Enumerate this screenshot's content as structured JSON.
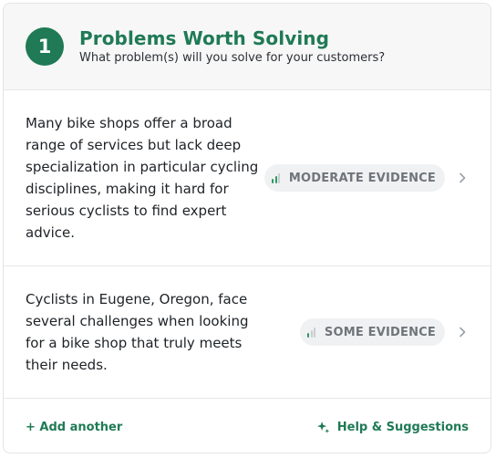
{
  "header": {
    "step_number": "1",
    "title": "Problems Worth Solving",
    "subtitle": "What problem(s) will you solve for your customers?"
  },
  "problems": [
    {
      "text": "Many bike shops offer a broad range of services but lack deep specialization in particular cycling disciplines, making it hard for serious cyclists to find expert advice.",
      "evidence_label": "MODERATE EVIDENCE",
      "evidence_level": 2,
      "evidence_max": 3
    },
    {
      "text": "Cyclists in Eugene, Oregon, face several challenges when looking for a bike shop that truly meets their needs.",
      "evidence_label": "SOME EVIDENCE",
      "evidence_level": 1,
      "evidence_max": 3
    }
  ],
  "footer": {
    "add_label": "+ Add another",
    "help_label": "Help & Suggestions"
  },
  "colors": {
    "brand_green": "#1f7a55",
    "signal_active": "#2f9a63",
    "signal_inactive": "#c9cdd1",
    "pill_bg": "#f0f1f2"
  },
  "icons": {
    "evidence": "signal-bars-icon",
    "row_action": "chevron-right-icon",
    "help": "sparkle-icon"
  }
}
